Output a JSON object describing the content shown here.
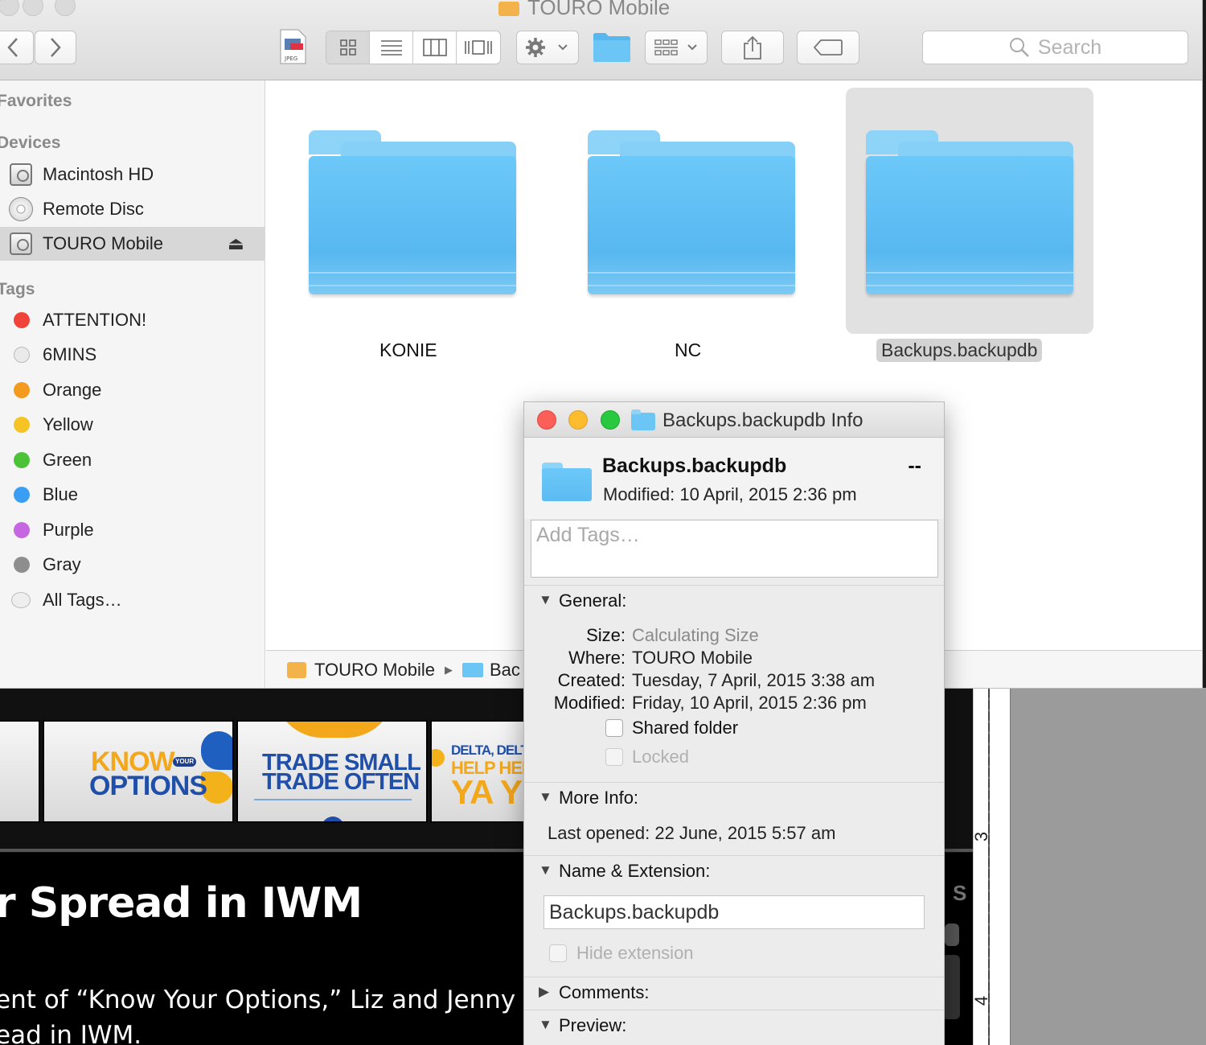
{
  "finder": {
    "title": "TOURO Mobile",
    "search_placeholder": "Search",
    "sidebar": {
      "favorites_header": "Favorites",
      "devices_header": "Devices",
      "tags_header": "Tags",
      "devices": [
        {
          "label": "Macintosh HD"
        },
        {
          "label": "Remote Disc"
        },
        {
          "label": "TOURO Mobile",
          "selected": true
        }
      ],
      "tags": [
        {
          "label": "ATTENTION!",
          "color": "#f0433a"
        },
        {
          "label": "6MINS",
          "color": "#e6e6e6"
        },
        {
          "label": "Orange",
          "color": "#f39a1f"
        },
        {
          "label": "Yellow",
          "color": "#f6c324"
        },
        {
          "label": "Green",
          "color": "#4cc239"
        },
        {
          "label": "Blue",
          "color": "#3a9ef5"
        },
        {
          "label": "Purple",
          "color": "#c567e0"
        },
        {
          "label": "Gray",
          "color": "#8e8e8e"
        },
        {
          "label": "All Tags…",
          "color": "#e0e0e0"
        }
      ]
    },
    "folders": [
      {
        "name": "KONIE"
      },
      {
        "name": "NC"
      },
      {
        "name": "Backups.backupdb",
        "selected": true
      }
    ],
    "pathbar": {
      "volume": "TOURO Mobile",
      "folder": "Bac"
    }
  },
  "info_window": {
    "title": "Backups.backupdb Info",
    "name": "Backups.backupdb",
    "size_short": "--",
    "modified_line": "Modified: 10 April, 2015 2:36 pm",
    "tags_placeholder": "Add Tags…",
    "general": {
      "header": "General:",
      "size_label": "Size:",
      "size_value": "Calculating Size",
      "where_label": "Where:",
      "where_value": "TOURO Mobile",
      "created_label": "Created:",
      "created_value": "Tuesday, 7 April, 2015 3:38 am",
      "modified_label": "Modified:",
      "modified_value": "Friday, 10 April, 2015 2:36 pm",
      "shared_folder_label": "Shared folder",
      "locked_label": "Locked"
    },
    "more_info": {
      "header": "More Info:",
      "last_opened": "Last opened: 22 June, 2015 5:57 am"
    },
    "name_extension": {
      "header": "Name & Extension:",
      "value": "Backups.backupdb",
      "hide_extension_label": "Hide extension"
    },
    "comments_header": "Comments:",
    "preview_header": "Preview:"
  },
  "background_page": {
    "thumb1_line1": "KNOW",
    "thumb1_small": "YOUR",
    "thumb1_line2": "OPTIONS",
    "thumb2_line1": "TRADE SMALL",
    "thumb2_line2": "TRADE OFTEN",
    "thumb3_line1": "DELTA, DELT",
    "thumb3_line2": "HELP HEL",
    "thumb3_line3": "YA Y",
    "headline": "r Spread in IWM",
    "body_line1": "ent of “Know Your Options,” Liz and Jenny walk",
    "body_line2": "ead in IWM.",
    "side_letter": "S",
    "ruler_3": "3",
    "ruler_4": "4"
  }
}
